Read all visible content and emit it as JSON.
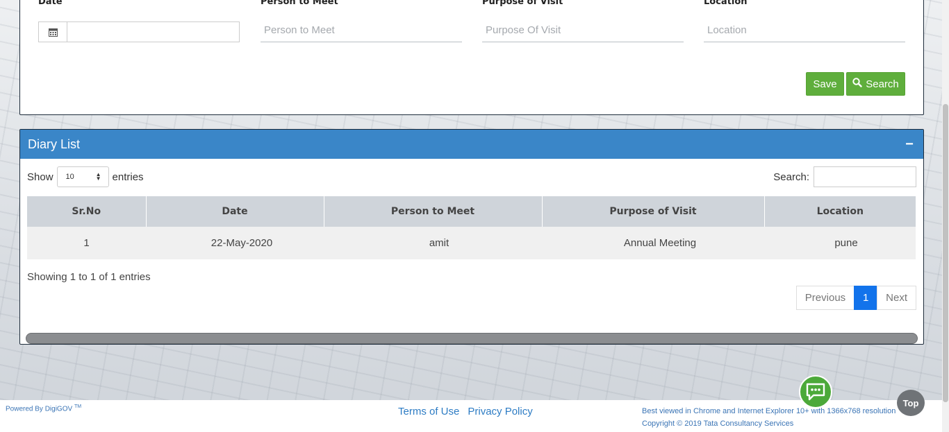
{
  "form": {
    "date_label": "Date",
    "date_value": "",
    "person_label": "Person to Meet",
    "person_placeholder": "Person to Meet",
    "purpose_label": "Purpose of Visit",
    "purpose_placeholder": "Purpose Of Visit",
    "location_label": "Location",
    "location_placeholder": "Location",
    "save_label": "Save",
    "search_label": "Search"
  },
  "diary": {
    "title": "Diary List",
    "collapse_symbol": "−",
    "show_label": "Show",
    "entries_value": "10",
    "entries_label": "entries",
    "search_label": "Search:",
    "columns": [
      "Sr.No",
      "Date",
      "Person to Meet",
      "Purpose of Visit",
      "Location"
    ],
    "rows": [
      {
        "srno": "1",
        "date": "22-May-2020",
        "person": "amit",
        "purpose": "Annual Meeting",
        "location": "pune"
      }
    ],
    "info": "Showing 1 to 1 of 1 entries",
    "pagination": {
      "previous": "Previous",
      "current": "1",
      "next": "Next"
    }
  },
  "footer": {
    "powered_by": "Powered By DigiGOV",
    "tm": "TM",
    "terms": "Terms of Use",
    "privacy": "Privacy Policy",
    "best_viewed": "Best viewed in Chrome and Internet Explorer 10+ with 1366x768 resolution",
    "copyright": "Copyright © 2019 Tata Consultancy Services"
  },
  "floating": {
    "top_label": "Top"
  },
  "icons": {
    "calendar": "calendar-icon",
    "search": "search-icon",
    "chat": "chat-icon"
  },
  "colors": {
    "accent_blue": "#3a86c8",
    "button_green": "#5fae3c",
    "page_active": "#1273eb"
  }
}
